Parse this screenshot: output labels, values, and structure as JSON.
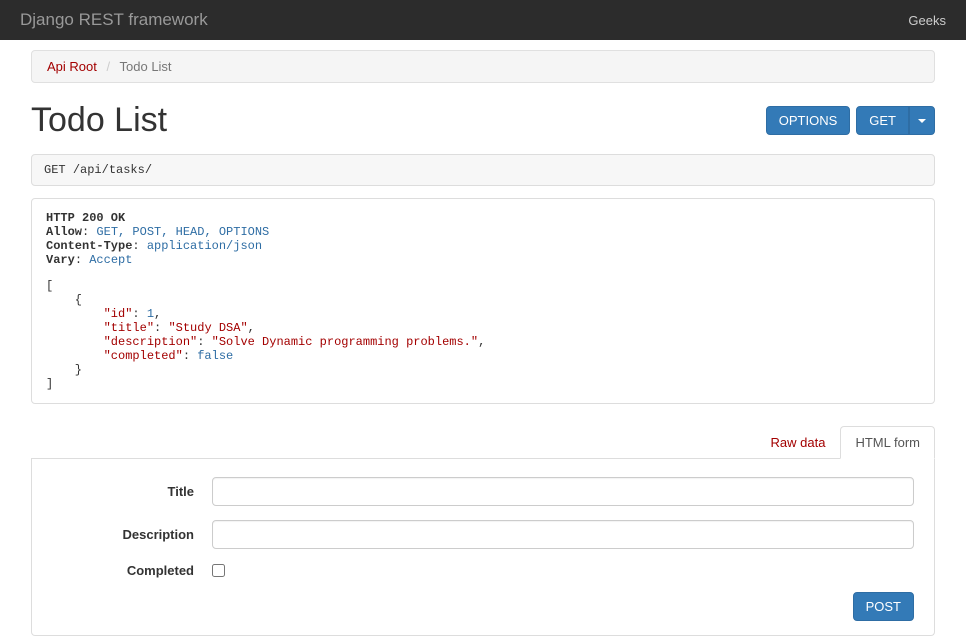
{
  "navbar": {
    "brand": "Django REST framework",
    "user": "Geeks"
  },
  "breadcrumb": {
    "root": "Api Root",
    "current": "Todo List"
  },
  "page": {
    "title": "Todo List"
  },
  "buttons": {
    "options": "OPTIONS",
    "get": "GET",
    "post": "POST"
  },
  "request": {
    "method": "GET",
    "path": "/api/tasks/"
  },
  "response": {
    "status_line": "HTTP 200 OK",
    "headers": [
      {
        "key": "Allow",
        "value": "GET, POST, HEAD, OPTIONS"
      },
      {
        "key": "Content-Type",
        "value": "application/json"
      },
      {
        "key": "Vary",
        "value": "Accept"
      }
    ],
    "body_items": [
      {
        "id": 1,
        "title": "Study DSA",
        "description": "Solve Dynamic programming problems.",
        "completed": false
      }
    ]
  },
  "tabs": {
    "raw": "Raw data",
    "html": "HTML form"
  },
  "form": {
    "title_label": "Title",
    "description_label": "Description",
    "completed_label": "Completed"
  }
}
